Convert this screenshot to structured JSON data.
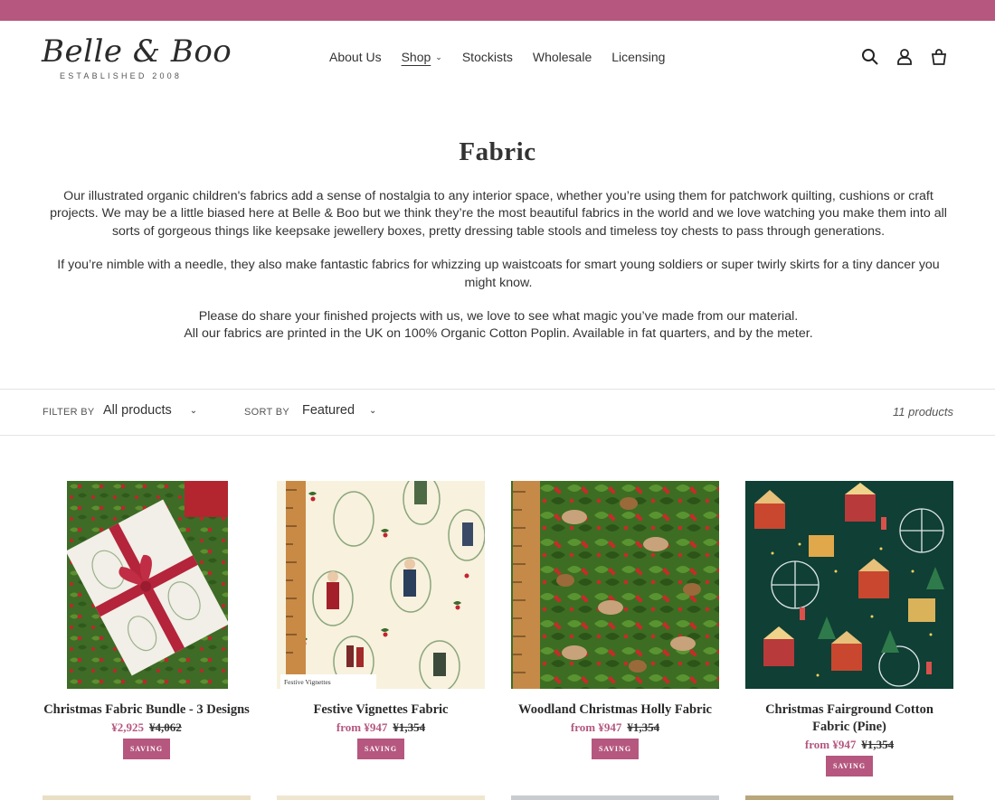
{
  "announcement": {
    "color": "#b5577f"
  },
  "brand": {
    "name": "Belle & Boo",
    "tagline": "ESTABLISHED 2008"
  },
  "nav": {
    "items": [
      {
        "label": "About Us"
      },
      {
        "label": "Shop"
      },
      {
        "label": "Stockists"
      },
      {
        "label": "Wholesale"
      },
      {
        "label": "Licensing"
      }
    ],
    "active": "Shop"
  },
  "header_icons": [
    "search-icon",
    "account-icon",
    "cart-icon"
  ],
  "page": {
    "title": "Fabric",
    "intro": [
      "Our illustrated organic children's fabrics add a sense of nostalgia to any interior space, whether you’re using them for patchwork quilting, cushions or craft projects. We may be a little biased here at Belle & Boo but we think they’re the most beautiful fabrics in the world and we love watching you make them into all sorts of gorgeous things like keepsake jewellery boxes, pretty dressing table stools and timeless toy chests to pass through generations.",
      "If you’re nimble with a needle, they also make fantastic fabrics for whizzing up waistcoats for smart young soldiers or super twirly skirts for a tiny dancer you might know.",
      "Please do share your finished projects with us, we love to see what magic you’ve made from our material.",
      "All our fabrics are printed in the UK on 100% Organic Cotton Poplin. Available in fat quarters, and by the meter."
    ]
  },
  "filters": {
    "filter_label": "FILTER BY",
    "filter_value": "All products",
    "sort_label": "SORT BY",
    "sort_value": "Featured",
    "count": "11 products"
  },
  "products": [
    {
      "name": "Christmas Fabric Bundle - 3 Designs",
      "price": "¥2,925",
      "compare": "¥4,062",
      "badge": "SAVING"
    },
    {
      "name": "Festive Vignettes Fabric",
      "price": "from ¥947",
      "compare": "¥1,354",
      "badge": "SAVING",
      "image_caption": "Festive Vignettes"
    },
    {
      "name": "Woodland Christmas Holly Fabric",
      "price": "from ¥947",
      "compare": "¥1,354",
      "badge": "SAVING"
    },
    {
      "name": "Christmas Fairground Cotton Fabric (Pine)",
      "price": "from ¥947",
      "compare": "¥1,354",
      "badge": "SAVING"
    }
  ],
  "colors": {
    "accent": "#b5577f",
    "pine": "#0f3f35",
    "holly": "#4a7a2a"
  }
}
